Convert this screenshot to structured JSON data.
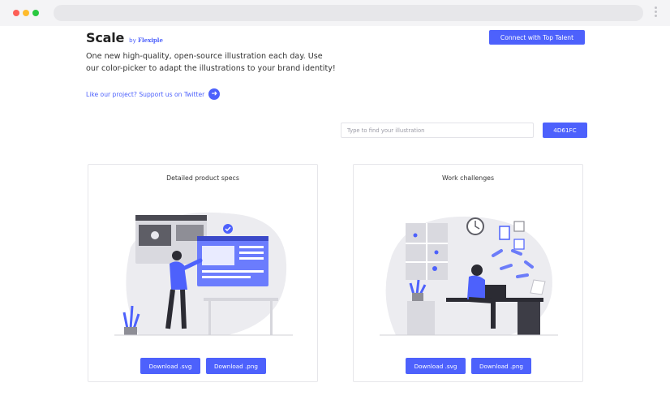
{
  "brand": {
    "name": "Scale",
    "by_prefix": "by",
    "by_name": "Flexiple"
  },
  "header": {
    "connect_label": "Connect with Top Talent"
  },
  "description": "One new high-quality, open-source illustration each day. Use our color-picker to adapt the illustrations to your brand identity!",
  "support_link": {
    "label": "Like our project? Support us on Twitter",
    "icon": "arrow-right-circle-icon"
  },
  "search": {
    "placeholder": "Type to find your illustration",
    "value": ""
  },
  "color_picker": {
    "value": "4D61FC"
  },
  "colors": {
    "accent": "#4D61FC",
    "dark": "#2b2b2b",
    "grey": "#e9e9ed"
  },
  "cards": [
    {
      "title": "Detailed product specs",
      "download_svg": "Download .svg",
      "download_png": "Download .png"
    },
    {
      "title": "Work challenges",
      "download_svg": "Download .svg",
      "download_png": "Download .png"
    }
  ]
}
